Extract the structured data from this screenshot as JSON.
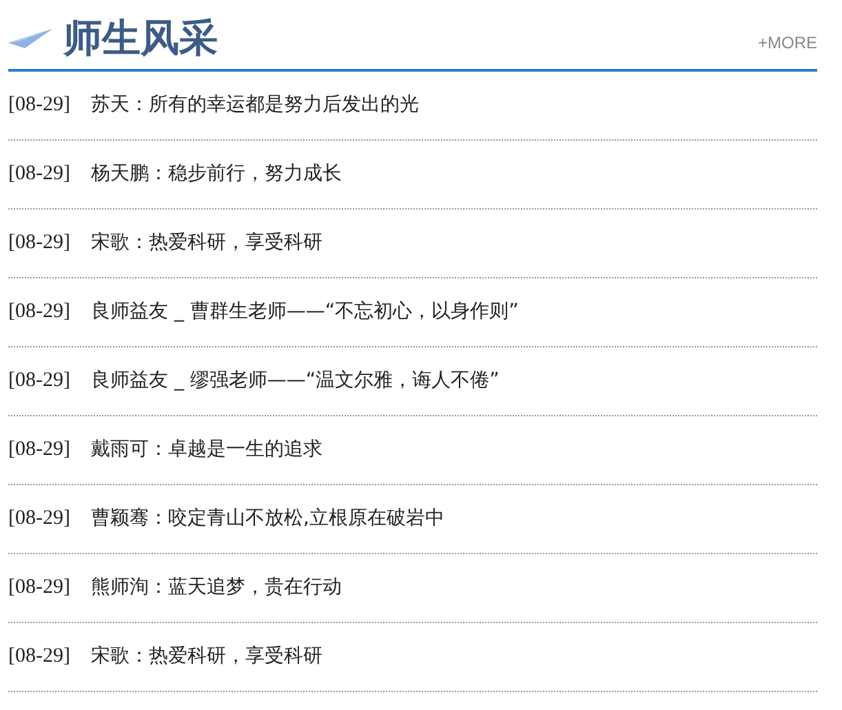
{
  "header": {
    "title": "师生风采",
    "more": "+MORE"
  },
  "items": [
    {
      "date": "[08-29]",
      "title": "苏天：所有的幸运都是努力后发出的光"
    },
    {
      "date": "[08-29]",
      "title": "杨天鹏：稳步前行，努力成长"
    },
    {
      "date": "[08-29]",
      "title": "宋歌：热爱科研，享受科研"
    },
    {
      "date": "[08-29]",
      "title": "良师益友 _ 曹群生老师——“不忘初心，以身作则”"
    },
    {
      "date": "[08-29]",
      "title": "良师益友 _ 缪强老师——“温文尔雅，诲人不倦”"
    },
    {
      "date": "[08-29]",
      "title": "戴雨可：卓越是一生的追求"
    },
    {
      "date": "[08-29]",
      "title": "曹颖骞：咬定青山不放松,立根原在破岩中"
    },
    {
      "date": "[08-29]",
      "title": "熊师洵：蓝天追梦，贵在行动"
    },
    {
      "date": "[08-29]",
      "title": "宋歌：热爱科研，享受科研"
    }
  ]
}
